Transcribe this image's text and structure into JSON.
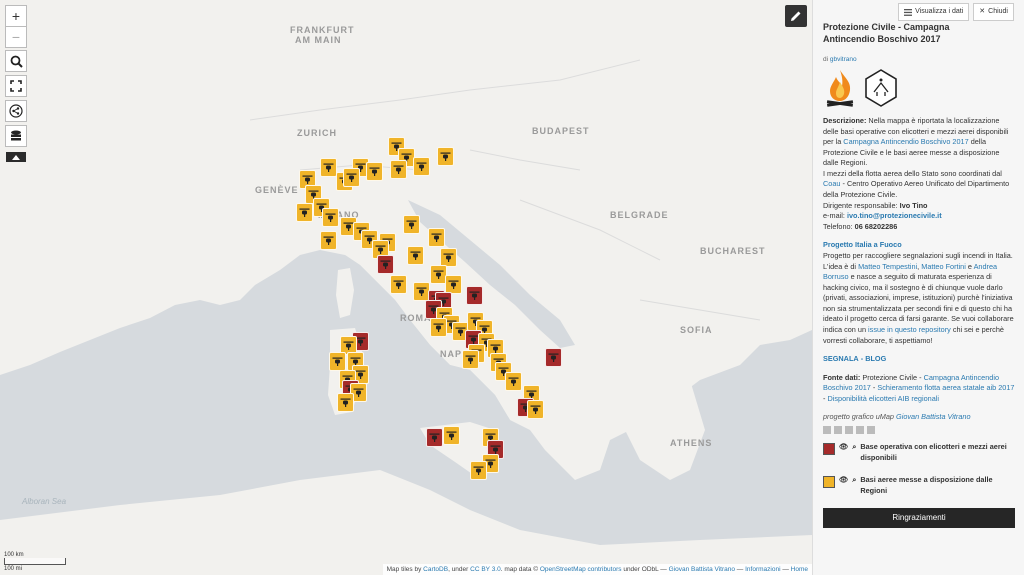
{
  "map": {
    "cities": [
      "FRANKFURT",
      "AM MAIN",
      "ZURICH",
      "MILANO",
      "BUDAPEST",
      "BELGRADE",
      "BUCHAREST",
      "ROMA",
      "NAPOLI",
      "ATHENS",
      "GENÈVE",
      "SOFIA"
    ],
    "seas": [
      "Alboran Sea"
    ],
    "scale_km": "100 km",
    "scale_mi": "100 mi",
    "zoom_in": "+",
    "zoom_out": "−",
    "icons": [
      "search-icon",
      "fullscreen-icon",
      "share-icon",
      "layers-icon",
      "collapse-icon",
      "pencil-icon"
    ],
    "marker_colors": {
      "base_operativa": "#a52a2a",
      "basi_regioni": "#f0b429"
    },
    "attribution": {
      "prefix": "Map tiles by",
      "tiles_link": "CartoDB",
      "under": ", under",
      "license_link": "CC BY 3.0",
      "data": ". map data ©",
      "osm_link": "OpenStreetMap contributors",
      "odbl": "under ODbL —",
      "author_link": "Giovan Battista Vitrano",
      "info_link": "Informazioni",
      "home_link": "Home"
    }
  },
  "panel": {
    "view_data_label": "Visualizza i dati",
    "close_label": "Chiudi",
    "title": "Protezione Civile - Campagna Antincendio Boschivo 2017",
    "by": "di",
    "author": "gbvitrano",
    "desc_label": "Descrizione:",
    "desc_text1": "Nella mappa è riportata la localizzazione delle basi operative con elicotteri e mezzi aerei disponibili per la",
    "desc_link1": "Campagna Antincendio Boschivo 2017",
    "desc_text2": "della Protezione Civile e le basi aeree messe a disposizione dalle Regioni.",
    "desc_text3": "I mezzi della flotta aerea dello Stato sono coordinati dal",
    "desc_link2": "Coau",
    "desc_text4": "- Centro Operativo Aereo Unificato del Dipartimento della Protezione Civile.",
    "resp_label": "Dirigente responsabile:",
    "resp_name": "Ivo Tino",
    "email_label": "e-mail:",
    "email": "ivo.tino@protezionecivile.it",
    "phone_label": "Telefono:",
    "phone": "06 68202286",
    "project_title": "Progetto Italia a Fuoco",
    "project_text1": "Progetto per raccogliere segnalazioni sugli incendi in Italia.",
    "project_text2": "L'idea è di",
    "p_name1": "Matteo Tempestini",
    "p_name2": "Matteo Fortini",
    "p_and": "e",
    "p_name3": "Andrea Borruso",
    "project_text3": "e nasce a seguito di maturata esperienza di hacking civico, ma il sostegno è di chiunque vuole darlo (privati, associazioni, imprese, istituzioni) purchè l'iniziativa non sia strumentalizzata per secondi fini e di questo chi ha ideato il progetto cerca di farsi garante. Se vuoi collaborare indica con un",
    "issue_link": "issue in questo repository",
    "project_text4": "chi sei e perchè vorresti collaborare, ti aspettiamo!",
    "segnala": "SEGNALA",
    "sep": "-",
    "blog": "BLOG",
    "source_label": "Fonte dati:",
    "source_text": "Protezione Civile -",
    "source_link1": "Campagna Antincendio Boschivo 2017",
    "source_link2": "Schieramento flotta aerea statale aib 2017",
    "source_link3": "Disponibilità elicotteri AIB regionali",
    "credit_text": "progetto grafico uMap",
    "credit_link": "Giovan Battista Vitrano",
    "legend": [
      {
        "label": "Base operativa con elicotteri e mezzi aerei disponibili",
        "color": "#a52a2a"
      },
      {
        "label": "Basi aeree messe a disposizione dalle Regioni",
        "color": "#f0b429"
      }
    ],
    "thanks_label": "Ringraziamenti"
  }
}
